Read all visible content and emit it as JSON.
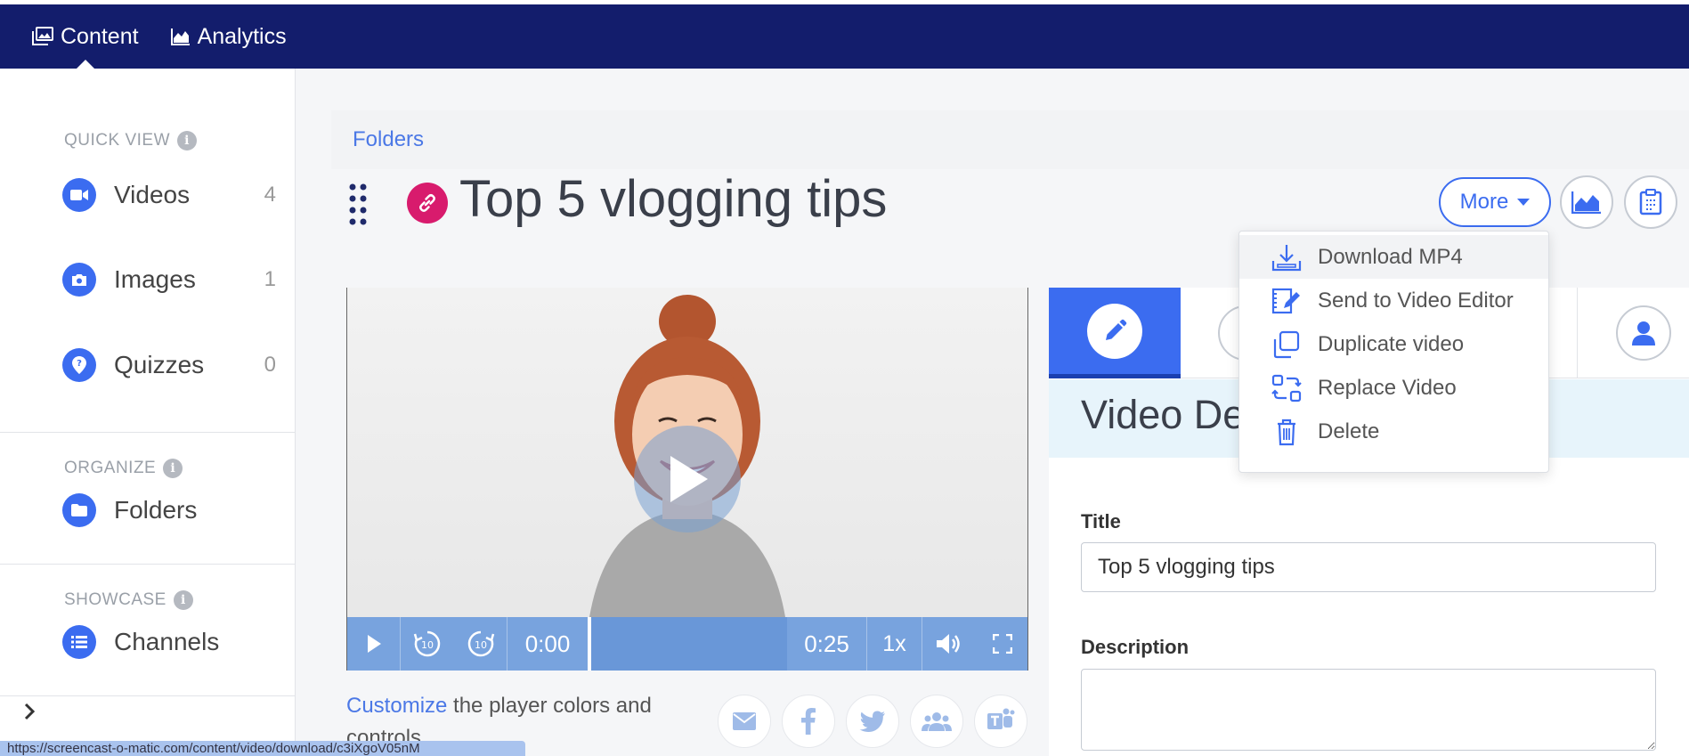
{
  "nav": {
    "items": [
      {
        "label": "Content",
        "icon": "images-icon",
        "active": true
      },
      {
        "label": "Analytics",
        "icon": "chart-area-icon",
        "active": false
      }
    ]
  },
  "sidebar": {
    "quick_view_label": "QUICK VIEW",
    "organize_label": "ORGANIZE",
    "showcase_label": "SHOWCASE",
    "videos": {
      "label": "Videos",
      "count": "4",
      "icon": "video-camera-icon"
    },
    "images": {
      "label": "Images",
      "count": "1",
      "icon": "camera-icon"
    },
    "quizzes": {
      "label": "Quizzes",
      "count": "0",
      "icon": "quiz-icon"
    },
    "folders": {
      "label": "Folders",
      "icon": "folder-icon"
    },
    "channels": {
      "label": "Channels",
      "icon": "list-icon"
    }
  },
  "breadcrumb": {
    "folders": "Folders"
  },
  "page": {
    "title": "Top 5 vlogging tips",
    "accent": "#d81b6d"
  },
  "toolbar": {
    "more_label": "More"
  },
  "menu": {
    "items": [
      {
        "label": "Download MP4",
        "icon": "download-icon"
      },
      {
        "label": "Send to Video Editor",
        "icon": "film-edit-icon"
      },
      {
        "label": "Duplicate video",
        "icon": "duplicate-icon"
      },
      {
        "label": "Replace Video",
        "icon": "replace-icon"
      },
      {
        "label": "Delete",
        "icon": "trash-icon"
      }
    ]
  },
  "player": {
    "current_time": "0:00",
    "duration": "0:25",
    "speed": "1x",
    "rewind": "10",
    "forward": "10",
    "progress": 0.0
  },
  "customize": {
    "link": "Customize",
    "text": " the player colors and controls"
  },
  "details": {
    "header": "Video Details",
    "title_label": "Title",
    "title_value": "Top 5 vlogging tips",
    "description_label": "Description",
    "description_value": ""
  },
  "status_bar": {
    "url": "https://screencast-o-matic.com/content/video/download/c3iXgoV05nM"
  },
  "colors": {
    "nav_bg": "#131d6c",
    "primary": "#3b6cf0",
    "link": "#4b78e6"
  }
}
